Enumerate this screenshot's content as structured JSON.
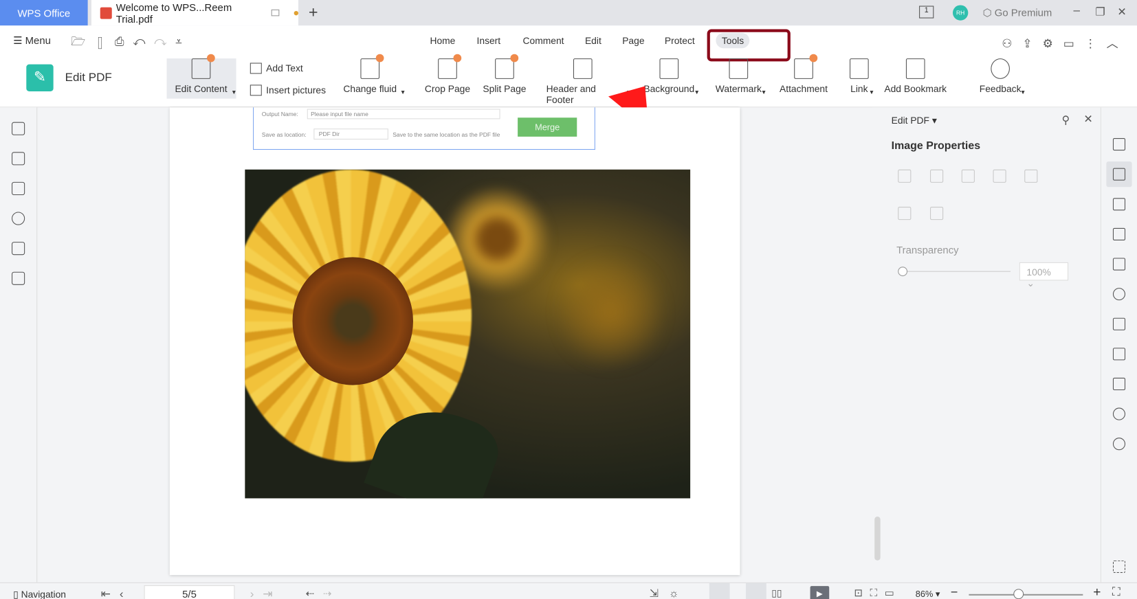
{
  "titlebar": {
    "app_tab": "WPS Office",
    "doc_tab": "Welcome to WPS...Reem Trial.pdf",
    "new_tab": "+",
    "go_premium": "Go Premium",
    "avatar_initials": "RH",
    "window_count": "1",
    "minimize": "–",
    "restore": "❐",
    "close": "✕"
  },
  "quickbar": {
    "menu": "Menu"
  },
  "menu_tabs": [
    "Home",
    "Insert",
    "Comment",
    "Edit",
    "Page",
    "Protect",
    "Tools"
  ],
  "active_tab": "Tools",
  "ribbon": {
    "title": "Edit PDF",
    "items": [
      {
        "label": "Edit Content",
        "icon": "edit-content-icon",
        "dropdown": true
      },
      {
        "label": "Add Text",
        "icon": "add-text-icon"
      },
      {
        "label": "Insert pictures",
        "icon": "insert-picture-icon"
      },
      {
        "label": "Change fluid",
        "icon": "eraser-icon",
        "dropdown": true
      },
      {
        "label": "Crop Page",
        "icon": "crop-page-icon"
      },
      {
        "label": "Split Page",
        "icon": "split-page-icon"
      },
      {
        "label": "Header and Footer",
        "icon": "header-footer-icon",
        "dropdown": true
      },
      {
        "label": "Background",
        "icon": "background-icon",
        "dropdown": true
      },
      {
        "label": "Watermark",
        "icon": "watermark-icon",
        "dropdown": true
      },
      {
        "label": "Attachment",
        "icon": "attachment-icon"
      },
      {
        "label": "Link",
        "icon": "link-icon",
        "dropdown": true
      },
      {
        "label": "Add Bookmark",
        "icon": "bookmark-add-icon"
      },
      {
        "label": "Feedback",
        "icon": "smiley-icon",
        "dropdown": true
      }
    ]
  },
  "document": {
    "merge_form": {
      "output_name_label": "Output Name:",
      "output_name_placeholder": "Please input file name",
      "save_location_label": "Save as location:",
      "save_location_value": "PDF Dir",
      "save_location_hint": "Save to the same location as the PDF file",
      "merge_button": "Merge"
    }
  },
  "annotation": {
    "highlight_color": "#8b0a1a",
    "arrow_color": "#ff1a1a"
  },
  "panel": {
    "header": "Edit PDF",
    "title": "Image Properties",
    "transparency_label": "Transparency",
    "transparency_value": "100%",
    "transparency_percent": 100
  },
  "statusbar": {
    "navigation": "Navigation",
    "page_value": "5/5",
    "zoom": "86%",
    "zoom_in": "+",
    "zoom_out": "−"
  }
}
